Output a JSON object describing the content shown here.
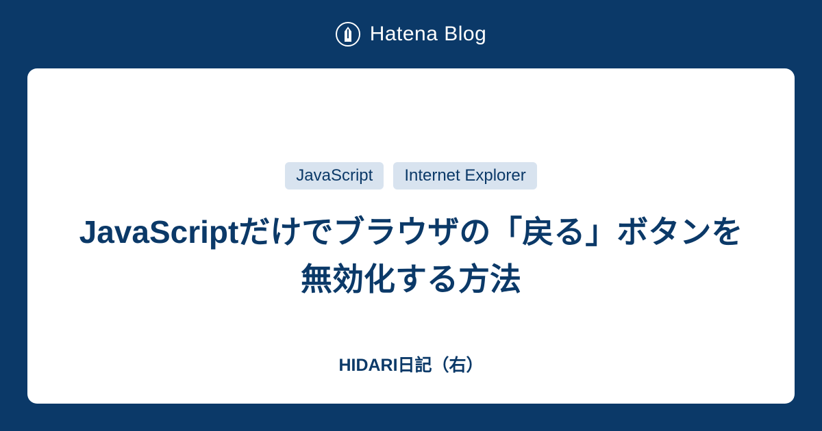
{
  "header": {
    "brand": "Hatena Blog"
  },
  "card": {
    "tags": [
      "JavaScript",
      "Internet Explorer"
    ],
    "title": "JavaScriptだけでブラウザの「戻る」ボタンを無効化する方法",
    "author": "HIDARI日記（右）"
  }
}
